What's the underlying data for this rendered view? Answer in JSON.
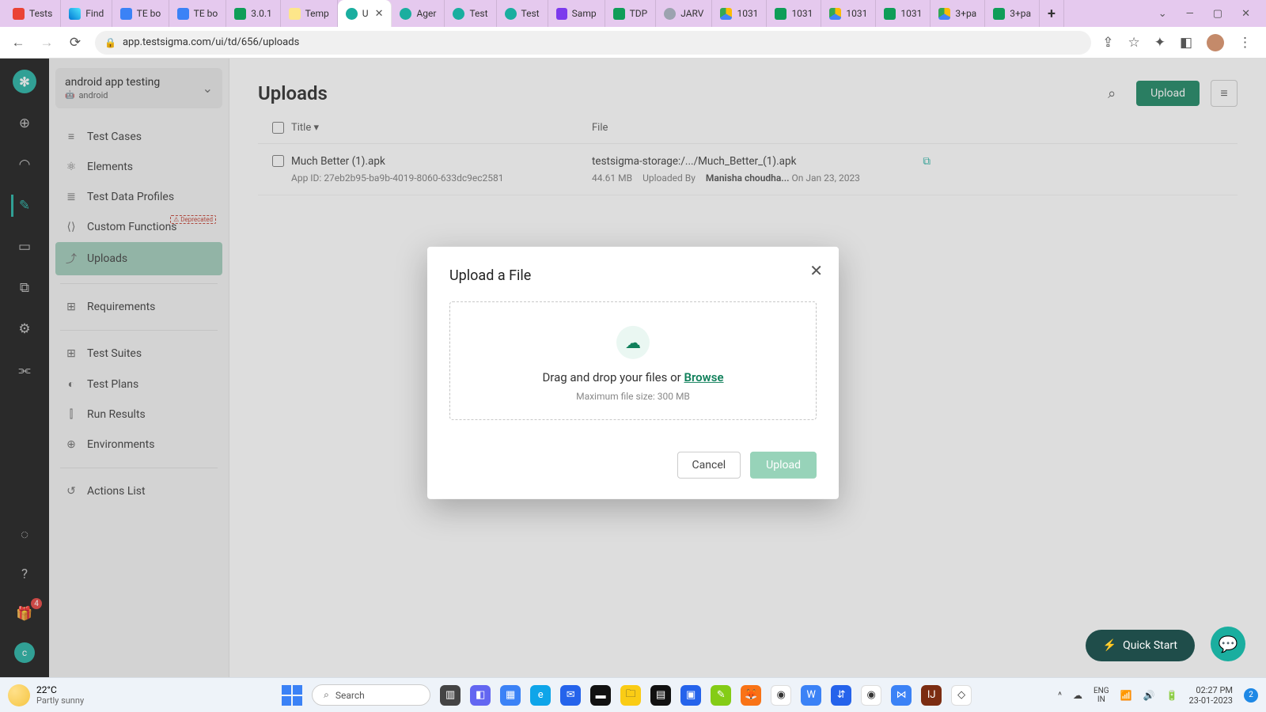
{
  "browser": {
    "tabs": [
      {
        "fav": "gmail",
        "label": "Tests"
      },
      {
        "fav": "bing",
        "label": "Find"
      },
      {
        "fav": "blue",
        "label": "TE bo"
      },
      {
        "fav": "blue",
        "label": "TE bo"
      },
      {
        "fav": "sheet",
        "label": "3.0.1"
      },
      {
        "fav": "egg",
        "label": "Temp"
      },
      {
        "fav": "gear",
        "label": "U",
        "active": true,
        "close": true
      },
      {
        "fav": "gear",
        "label": "Ager"
      },
      {
        "fav": "gear",
        "label": "Test"
      },
      {
        "fav": "gear",
        "label": "Test"
      },
      {
        "fav": "purple",
        "label": "Samp"
      },
      {
        "fav": "sheet",
        "label": "TDP"
      },
      {
        "fav": "globe",
        "label": "JARV"
      },
      {
        "fav": "drive",
        "label": "1031"
      },
      {
        "fav": "sheet",
        "label": "1031"
      },
      {
        "fav": "drive",
        "label": "1031"
      },
      {
        "fav": "sheet",
        "label": "1031"
      },
      {
        "fav": "drive",
        "label": "3+pa"
      },
      {
        "fav": "sheet",
        "label": "3+pa"
      }
    ],
    "url": "app.testsigma.com/ui/td/656/uploads"
  },
  "project": {
    "name": "android app testing",
    "platform": "android"
  },
  "sidenav": {
    "items1": [
      {
        "icon": "≡",
        "label": "Test Cases"
      },
      {
        "icon": "⚛",
        "label": "Elements"
      },
      {
        "icon": "≣",
        "label": "Test Data Profiles"
      },
      {
        "icon": "⟨⟩",
        "label": "Custom Functions",
        "deprecated": "⚠ Deprecated"
      },
      {
        "icon": "⤴",
        "label": "Uploads",
        "active": true
      }
    ],
    "items2": [
      {
        "icon": "⊞",
        "label": "Requirements"
      }
    ],
    "items3": [
      {
        "icon": "⊞",
        "label": "Test Suites"
      },
      {
        "icon": "◐",
        "label": "Test Plans"
      },
      {
        "icon": "⫿",
        "label": "Run Results"
      },
      {
        "icon": "⊕",
        "label": "Environments"
      }
    ],
    "items4": [
      {
        "icon": "↺",
        "label": "Actions List"
      }
    ]
  },
  "page": {
    "title": "Uploads",
    "upload_btn": "Upload",
    "columns": {
      "title": "Title",
      "file": "File"
    },
    "row": {
      "name": "Much Better (1).apk",
      "appid_label": "App ID:",
      "appid": "27eb2b95-ba9b-4019-8060-633dc9ec2581",
      "path": "testsigma-storage:/.../Much_Better_(1).apk",
      "size": "44.61 MB",
      "by_label": "Uploaded By",
      "by": "Manisha choudha...",
      "date": "On Jan 23, 2023"
    }
  },
  "modal": {
    "title": "Upload a File",
    "drop_text": "Drag and drop your files or ",
    "browse": "Browse",
    "note": "Maximum file size: 300 MB",
    "cancel": "Cancel",
    "upload": "Upload"
  },
  "float": {
    "quick": "Quick Start"
  },
  "taskbar": {
    "weather": {
      "temp": "22°C",
      "desc": "Partly sunny"
    },
    "search": "Search",
    "lang1": "ENG",
    "lang2": "IN",
    "time": "02:27 PM",
    "date": "23-01-2023",
    "notif": "2"
  },
  "rail": {
    "badge": "4",
    "user": "c"
  }
}
